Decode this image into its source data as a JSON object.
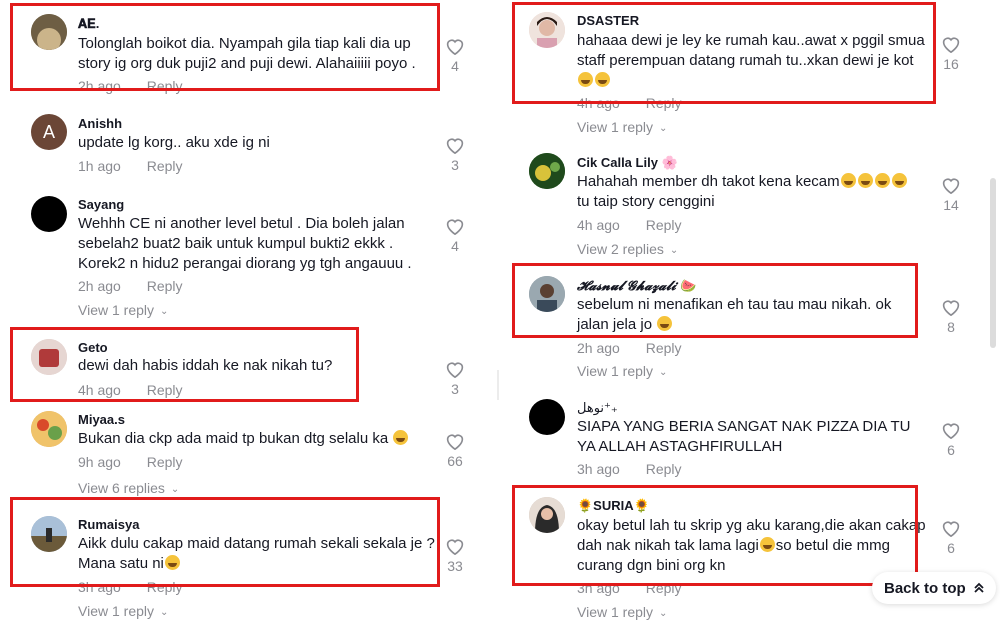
{
  "left_comments": [
    {
      "username": "𝐀𝐄.",
      "text": "Tolonglah boikot dia. Nyampah gila tiap kali dia up story ig org duk puji2 and puji dewi. Alahaiiiii poyo .",
      "time": "2h ago",
      "reply_label": "Reply",
      "likes": "4",
      "view_replies": "",
      "avatar_icon": "avatar-photo-icon",
      "avatar_color": "#8a7a5a"
    },
    {
      "username": "Anishh",
      "text": "update lg korg.. aku xde ig ni",
      "time": "1h ago",
      "reply_label": "Reply",
      "likes": "3",
      "view_replies": "",
      "avatar_letter": "A",
      "avatar_color": "#6b4636"
    },
    {
      "username": "Sayang",
      "text": "Wehhh CE ni another level betul . Dia boleh jalan sebelah2 buat2 baik untuk kumpul bukti2 ekkk . Korek2 n hidu2 perangai diorang yg tgh angauuu .",
      "time": "2h ago",
      "reply_label": "Reply",
      "likes": "4",
      "view_replies": "View 1 reply",
      "avatar_color": "#000000"
    },
    {
      "username": "Geto",
      "text": "dewi dah habis iddah ke nak nikah tu?",
      "time": "4h ago",
      "reply_label": "Reply",
      "likes": "3",
      "view_replies": "",
      "avatar_color": "#d9c3c0"
    },
    {
      "username": "Miyaa.s",
      "text": "Bukan dia ckp ada maid tp bukan dtg selalu ka",
      "time": "9h ago",
      "reply_label": "Reply",
      "likes": "66",
      "view_replies": "View 6 replies",
      "avatar_color": "#d9a55a"
    },
    {
      "username": "Rumaisya",
      "text": "Aikk dulu cakap maid datang rumah sekali sekala je ? Mana satu ni",
      "time": "3h ago",
      "reply_label": "Reply",
      "likes": "33",
      "view_replies": "View 1 reply",
      "avatar_color": "#8aa0b8"
    }
  ],
  "right_comments": [
    {
      "username": "DSASTER",
      "text": "hahaaa dewi je ley ke rumah kau..awat x pggil smua staff perempuan datang rumah tu..xkan dewi je kot",
      "time": "4h ago",
      "reply_label": "Reply",
      "likes": "16",
      "view_replies": "View 1 reply",
      "avatar_color": "#e8c9c0"
    },
    {
      "username": "Cik Calla Lily 🌸",
      "text": "Hahahah member dh takot kena kecam tu taip story cenggini",
      "time": "4h ago",
      "reply_label": "Reply",
      "likes": "14",
      "view_replies": "View 2 replies",
      "avatar_color": "#2e6b2a"
    },
    {
      "username": "𝓗𝓪𝓼𝓷𝓾𝓵 𝓖𝓱𝓪𝔃𝓪𝓵𝓲 🍉",
      "text": "sebelum ni menafikan eh tau tau mau nikah. ok jalan jela jo",
      "time": "2h ago",
      "reply_label": "Reply",
      "likes": "8",
      "view_replies": "View 1 reply",
      "avatar_color": "#7d8d98"
    },
    {
      "username": "نوهل⁺₊",
      "text": "SIAPA YANG BERIA SANGAT NAK PIZZA DIA TU YA ALLAH ASTAGHFIRULLAH",
      "time": "3h ago",
      "reply_label": "Reply",
      "likes": "6",
      "view_replies": "",
      "avatar_color": "#000000"
    },
    {
      "username": "🌻SURIA🌻",
      "text": "okay betul lah tu skrip yg aku karang,die akan cakap dah nak nikah tak lama lagi so betul die mmg curang dgn bini org kn",
      "time": "3h ago",
      "reply_label": "Reply",
      "likes": "6",
      "view_replies": "View 1 reply",
      "avatar_color": "#c7b8ad"
    }
  ],
  "back_to_top": {
    "label": "Back to top",
    "icon": "double-chevron-up-icon"
  },
  "colors": {
    "highlight": "#e11b1b",
    "muted_text": "#8a8b91",
    "primary_text": "#161823"
  }
}
